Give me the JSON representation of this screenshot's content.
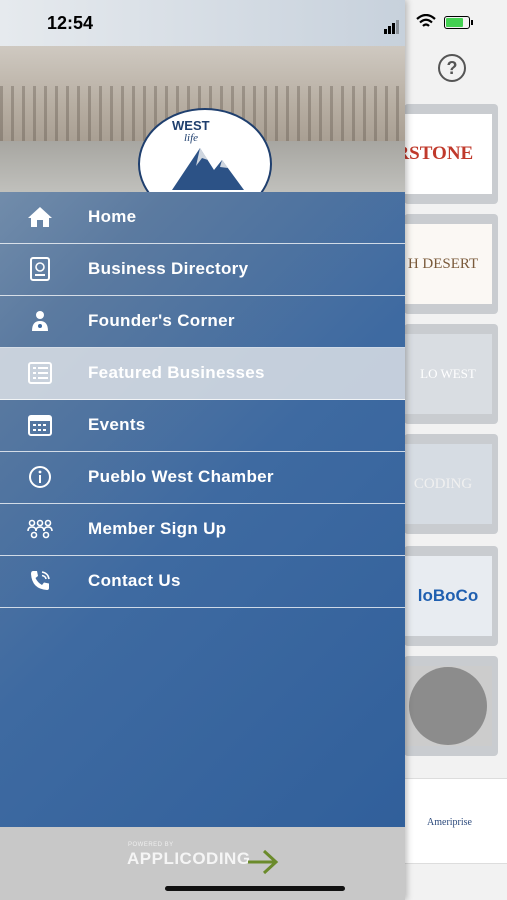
{
  "status": {
    "time": "12:54"
  },
  "drawer": {
    "logo": {
      "brand": "WEST",
      "script": "life"
    },
    "menu": [
      {
        "label": "Home",
        "icon": "home-icon",
        "active": false
      },
      {
        "label": "Business Directory",
        "icon": "directory-icon",
        "active": false
      },
      {
        "label": "Founder's Corner",
        "icon": "founder-icon",
        "active": false
      },
      {
        "label": "Featured Businesses",
        "icon": "list-icon",
        "active": true
      },
      {
        "label": "Events",
        "icon": "calendar-icon",
        "active": false
      },
      {
        "label": "Pueblo West Chamber",
        "icon": "info-icon",
        "active": false
      },
      {
        "label": "Member Sign Up",
        "icon": "members-icon",
        "active": false
      },
      {
        "label": "Contact Us",
        "icon": "phone-icon",
        "active": false
      }
    ],
    "footer": {
      "powered": "POWERED BY",
      "brand": "APPLICODING"
    }
  },
  "background": {
    "help": "?",
    "cards": [
      "ERSTONE",
      "H DESERT",
      "LO WEST",
      "CODING",
      "loBoCo",
      "",
      "Ameriprise"
    ]
  },
  "colors": {
    "drawer_blue": "#2f5e9a",
    "active_row": "#dce1e6",
    "battery_green": "#44d152"
  }
}
